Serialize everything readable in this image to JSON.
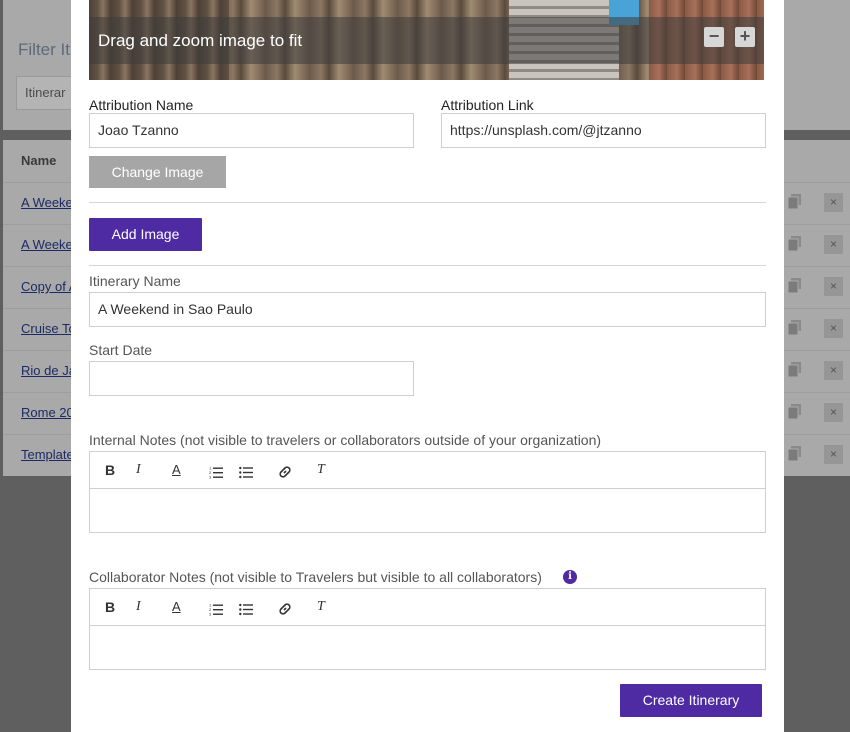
{
  "background": {
    "filter_label": "Filter It",
    "search_value": "Itinerar",
    "column_name": "Name",
    "rows": [
      {
        "name": "A Weeke"
      },
      {
        "name": "A Weeke"
      },
      {
        "name": "Copy of A"
      },
      {
        "name": "Cruise To"
      },
      {
        "name": "Rio de Ja"
      },
      {
        "name": "Rome 20"
      },
      {
        "name": "Template"
      }
    ],
    "row_icons": [
      "copy-icon",
      "close-icon"
    ],
    "close_glyph": "×"
  },
  "modal": {
    "image_hint": "Drag and zoom image to fit",
    "zoom_out_glyph": "−",
    "zoom_in_glyph": "+",
    "attribution_name_label": "Attribution Name",
    "attribution_name_value": "Joao Tzanno",
    "attribution_link_label": "Attribution Link",
    "attribution_link_value": "https://unsplash.com/@jtzanno",
    "change_image_label": "Change Image",
    "add_image_label": "Add Image",
    "itinerary_name_label": "Itinerary Name",
    "itinerary_name_value": "A Weekend in Sao Paulo",
    "start_date_label": "Start Date",
    "start_date_value": "",
    "internal_notes_label": "Internal Notes (not visible to travelers or collaborators outside of your organization)",
    "collaborator_notes_label": "Collaborator Notes (not visible to Travelers but visible to all collaborators)",
    "info_glyph": "i",
    "toolbar": {
      "bold": "B",
      "italic": "I",
      "font_color": "A",
      "clear_format": "T"
    },
    "create_button_label": "Create Itinerary"
  },
  "colors": {
    "accent": "#4e2aa3",
    "button_gray": "#a6a6a6",
    "overlay": "#5f5f5f"
  }
}
